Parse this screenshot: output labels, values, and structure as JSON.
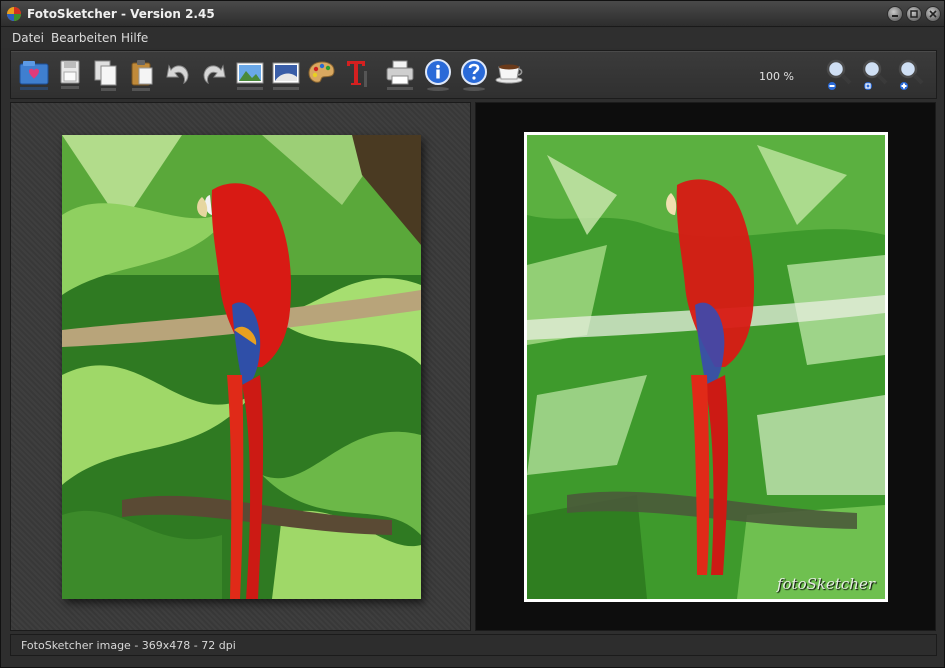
{
  "window": {
    "title": "FotoSketcher - Version 2.45"
  },
  "menu": {
    "items": [
      "Datei",
      "Bearbeiten",
      "Hilfe"
    ]
  },
  "toolbar": {
    "buttons": [
      "open-image",
      "save",
      "copy",
      "paste",
      "undo",
      "redo",
      "original-image",
      "sketch-image",
      "drawing-parameters",
      "add-text",
      "print",
      "info",
      "help",
      "donate"
    ],
    "zoom_level": "100 %"
  },
  "panels": {
    "sketch_watermark": "fotoSketcher"
  },
  "status": {
    "text": "FotoSketcher image - 369x478 - 72 dpi"
  },
  "colors": {
    "window_bg": "#2e2e2e",
    "panel_left_bg": "#3a3a3a",
    "panel_right_bg": "#0d0d0d",
    "parrot_red": "#d81a14",
    "foliage_green": "#3e9a2c"
  }
}
